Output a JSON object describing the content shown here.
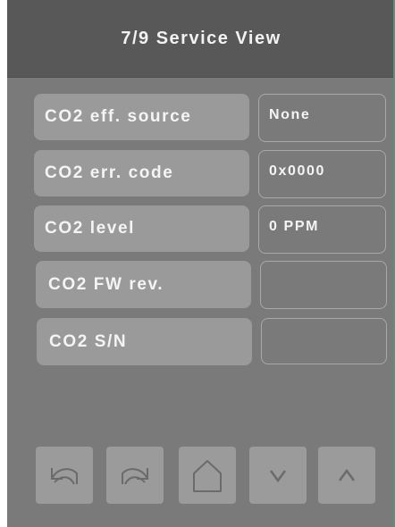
{
  "header": {
    "title": "7/9 Service View"
  },
  "rows": [
    {
      "label": "CO2 eff. source",
      "value": "None"
    },
    {
      "label": "CO2 err. code",
      "value": "0x0000"
    },
    {
      "label": "CO2 level",
      "value": "0 PPM"
    },
    {
      "label": "CO2 FW rev.",
      "value": ""
    },
    {
      "label": "CO2 S/N",
      "value": ""
    }
  ],
  "footer": {
    "buttons": [
      {
        "icon": "undo-icon"
      },
      {
        "icon": "redo-icon"
      },
      {
        "icon": "home-icon"
      },
      {
        "icon": "chevron-down-icon"
      },
      {
        "icon": "chevron-up-icon"
      }
    ]
  },
  "colors": {
    "background": "#7a7a7a",
    "header": "#585858",
    "label_fill": "#9a9a9a",
    "button_fill": "#9b9b9b",
    "icon_stroke": "#6b6b6b",
    "text": "#f4f4f4"
  }
}
